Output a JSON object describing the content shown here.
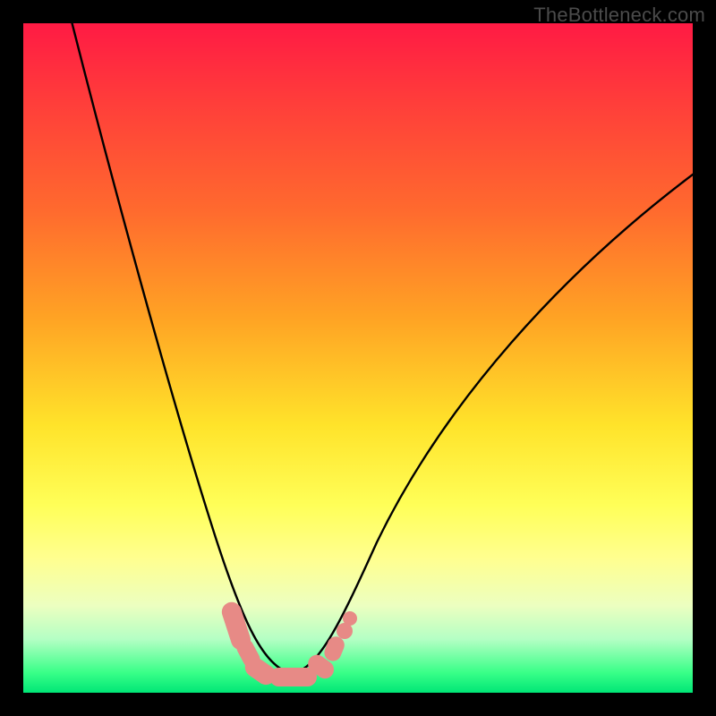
{
  "attribution": "TheBottleneck.com",
  "colors": {
    "frame": "#000000",
    "curve": "#000000",
    "marker": "#e78a86",
    "gradient_stops": [
      "#ff1a44",
      "#ff3e3a",
      "#ff6a2e",
      "#ffa324",
      "#ffe32a",
      "#ffff58",
      "#ffff90",
      "#ecffc0",
      "#b4ffc4",
      "#39ff88",
      "#00e676"
    ]
  },
  "chart_data": {
    "type": "line",
    "title": "",
    "xlabel": "",
    "ylabel": "",
    "xlim": [
      0,
      100
    ],
    "ylim": [
      0,
      100
    ],
    "note": "x and y in percent of plot area (0 = left/top edge, 100 = right/bottom). Two curves meeting near bottom; several rounded markers cluster around the valley.",
    "series": [
      {
        "name": "left-curve",
        "x": [
          7,
          10,
          14,
          18,
          22,
          25,
          28,
          30,
          33,
          35,
          40
        ],
        "y": [
          0,
          14,
          30,
          46,
          60,
          72,
          82,
          88,
          94,
          97,
          97
        ]
      },
      {
        "name": "right-curve",
        "x": [
          40,
          43,
          46,
          49,
          54,
          60,
          68,
          78,
          90,
          100
        ],
        "y": [
          97,
          96,
          92,
          86,
          76,
          64,
          52,
          40,
          30,
          22
        ]
      }
    ],
    "markers": [
      {
        "name": "marker-a",
        "cx": 31.8,
        "cy": 90.0,
        "w": 2.9,
        "h": 7.4,
        "angle": -18
      },
      {
        "name": "marker-b",
        "cx": 33.6,
        "cy": 94.2,
        "w": 2.6,
        "h": 4.6,
        "angle": -28
      },
      {
        "name": "marker-c",
        "cx": 35.5,
        "cy": 96.7,
        "w": 3.0,
        "h": 5.0,
        "angle": -55
      },
      {
        "name": "marker-d",
        "cx": 40.3,
        "cy": 97.6,
        "w": 7.0,
        "h": 2.8,
        "angle": 0
      },
      {
        "name": "marker-e",
        "cx": 44.5,
        "cy": 96.2,
        "w": 4.2,
        "h": 2.7,
        "angle": 36
      },
      {
        "name": "marker-f",
        "cx": 46.5,
        "cy": 93.5,
        "w": 2.6,
        "h": 3.8,
        "angle": 22
      },
      {
        "name": "marker-g",
        "cx": 48.8,
        "cy": 88.9,
        "w": 2.2,
        "h": 2.2,
        "angle": 0
      },
      {
        "name": "marker-h",
        "cx": 48.0,
        "cy": 90.8,
        "w": 2.4,
        "h": 2.4,
        "angle": 0
      }
    ]
  }
}
